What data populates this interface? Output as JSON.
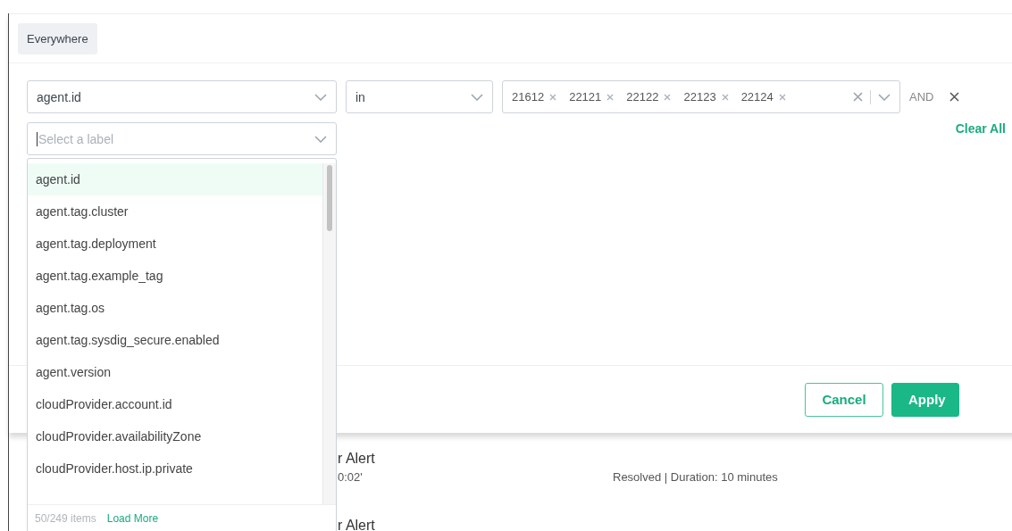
{
  "scope_chip": "Everywhere",
  "filter": {
    "label_field": "agent.id",
    "operator": "in",
    "values": [
      "21612",
      "22121",
      "22122",
      "22123",
      "22124"
    ],
    "joiner": "AND"
  },
  "label_select": {
    "placeholder": "Select a label"
  },
  "clear_all": "Clear All",
  "dropdown": {
    "options": [
      {
        "label": "agent.id",
        "selected": true
      },
      {
        "label": "agent.tag.cluster",
        "selected": false
      },
      {
        "label": "agent.tag.deployment",
        "selected": false
      },
      {
        "label": "agent.tag.example_tag",
        "selected": false
      },
      {
        "label": "agent.tag.os",
        "selected": false
      },
      {
        "label": "agent.tag.sysdig_secure.enabled",
        "selected": false
      },
      {
        "label": "agent.version",
        "selected": false
      },
      {
        "label": "cloudProvider.account.id",
        "selected": false
      },
      {
        "label": "cloudProvider.availabilityZone",
        "selected": false
      },
      {
        "label": "cloudProvider.host.ip.private",
        "selected": false
      }
    ],
    "count": "50/249 items",
    "load_more": "Load More"
  },
  "buttons": [
    {
      "label": "Cancel",
      "kind": "secondary"
    },
    {
      "label": "Apply",
      "kind": "primary"
    }
  ],
  "events": [
    {
      "title": "r Alert",
      "time": "0:02'",
      "status": "Resolved | Duration: 10 minutes"
    },
    {
      "title": "r Alert"
    }
  ]
}
